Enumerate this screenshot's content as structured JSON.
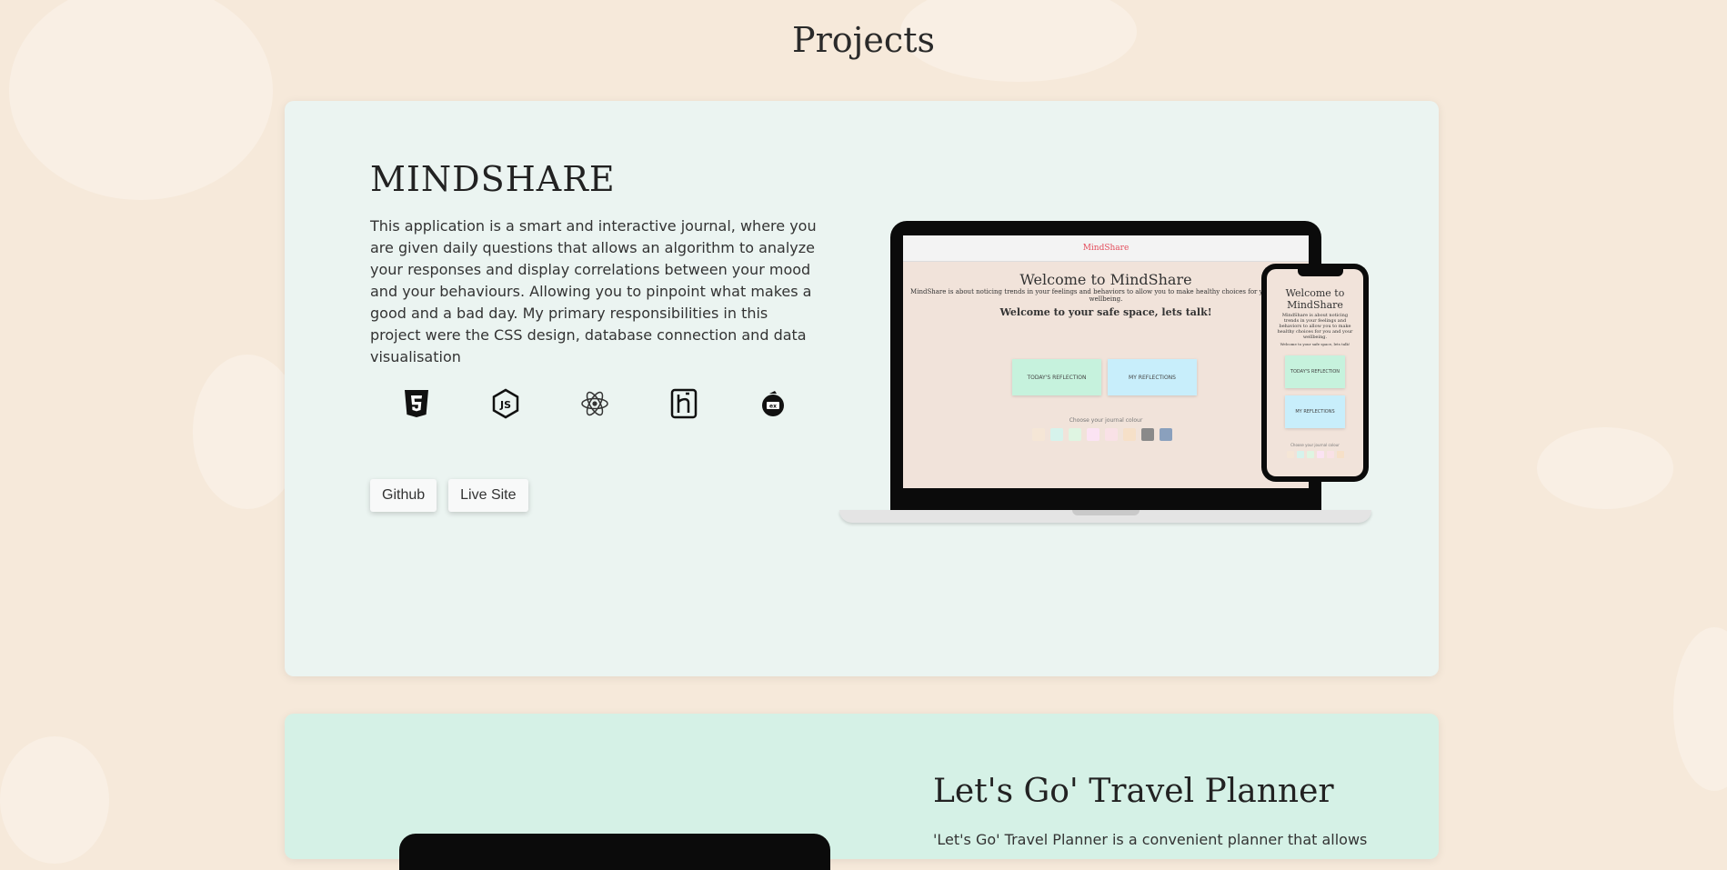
{
  "page": {
    "title": "Projects"
  },
  "projects": [
    {
      "title": "MINDSHARE",
      "description": "This application is a smart and interactive journal, where you are given daily questions that allows an algorithm to analyze your responses and display correlations between your mood and your behaviours. Allowing you to pinpoint what makes a good and a bad day. My primary responsibilities in this project were the CSS design, database connection and data visualisation",
      "tech_icons": [
        "html5-icon",
        "nodejs-icon",
        "react-icon",
        "heroku-icon",
        "express-icon"
      ],
      "buttons": {
        "github": "Github",
        "live_site": "Live Site"
      },
      "mockup": {
        "nav_brand": "MindShare",
        "heading": "Welcome to MindShare",
        "subtext": "MindShare is about noticing trends in your feelings and behaviors to allow you to make healthy choices for you and your wellbeing.",
        "tagline": "Welcome to your safe space, lets talk!",
        "btn_reflection": "TODAY'S REFLECTION",
        "btn_reflections": "MY REFLECTIONS",
        "choose_colour": "Choose your journal colour",
        "swatches": [
          "#f5e6d6",
          "#d6f3ec",
          "#dff5e2",
          "#fbe3f3",
          "#f9e1e6",
          "#f6e0c8",
          "#8a8a8a",
          "#8aa0bd"
        ]
      },
      "colors": {
        "card_bg": "#ebf4f1"
      }
    },
    {
      "title": "Let's Go' Travel Planner",
      "description": "'Let's Go' Travel Planner is a convenient planner that allows",
      "colors": {
        "card_bg": "#d5f1e6"
      }
    }
  ],
  "colors": {
    "page_bg": "#f6e9da"
  }
}
